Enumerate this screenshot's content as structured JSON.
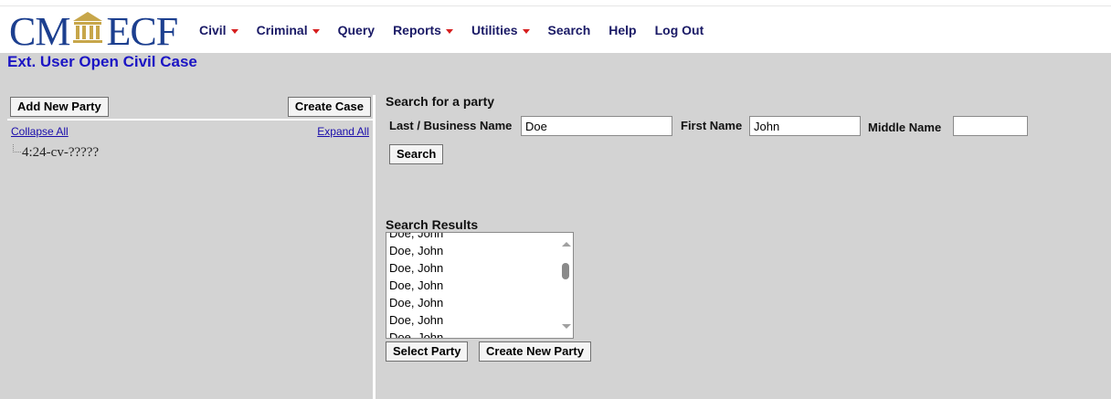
{
  "app": {
    "logo_left": "CM",
    "logo_right": "ECF",
    "logo_seal_icon": "courthouse-icon"
  },
  "menu": [
    {
      "label": "Civil",
      "dropdown": true
    },
    {
      "label": "Criminal",
      "dropdown": true
    },
    {
      "label": "Query",
      "dropdown": false
    },
    {
      "label": "Reports",
      "dropdown": true
    },
    {
      "label": "Utilities",
      "dropdown": true
    },
    {
      "label": "Search",
      "dropdown": false
    },
    {
      "label": "Help",
      "dropdown": false
    },
    {
      "label": "Log Out",
      "dropdown": false
    }
  ],
  "page": {
    "title": "Ext. User Open Civil Case"
  },
  "left_panel": {
    "add_new_party_label": "Add New Party",
    "create_case_label": "Create Case",
    "collapse_all_label": "Collapse All",
    "expand_all_label": "Expand All",
    "case_node": "4:24-cv-?????"
  },
  "search": {
    "section_title": "Search for a party",
    "last_name_label": "Last / Business Name",
    "last_name_value": "Doe",
    "first_name_label": "First Name",
    "first_name_value": "John",
    "middle_name_label": "Middle Name",
    "middle_name_value": "",
    "search_button_label": "Search"
  },
  "results": {
    "title": "Search Results",
    "items": [
      "Doe, John",
      "Doe, John",
      "Doe, John",
      "Doe, John",
      "Doe, John",
      "Doe, John",
      "Doe, John"
    ],
    "select_party_label": "Select Party",
    "create_new_party_label": "Create New Party"
  },
  "colors": {
    "background": "#d3d3d3",
    "title": "#1b14c4",
    "menu_text": "#1a1a66",
    "caret": "#d62020",
    "logo": "#1c3f8f"
  }
}
